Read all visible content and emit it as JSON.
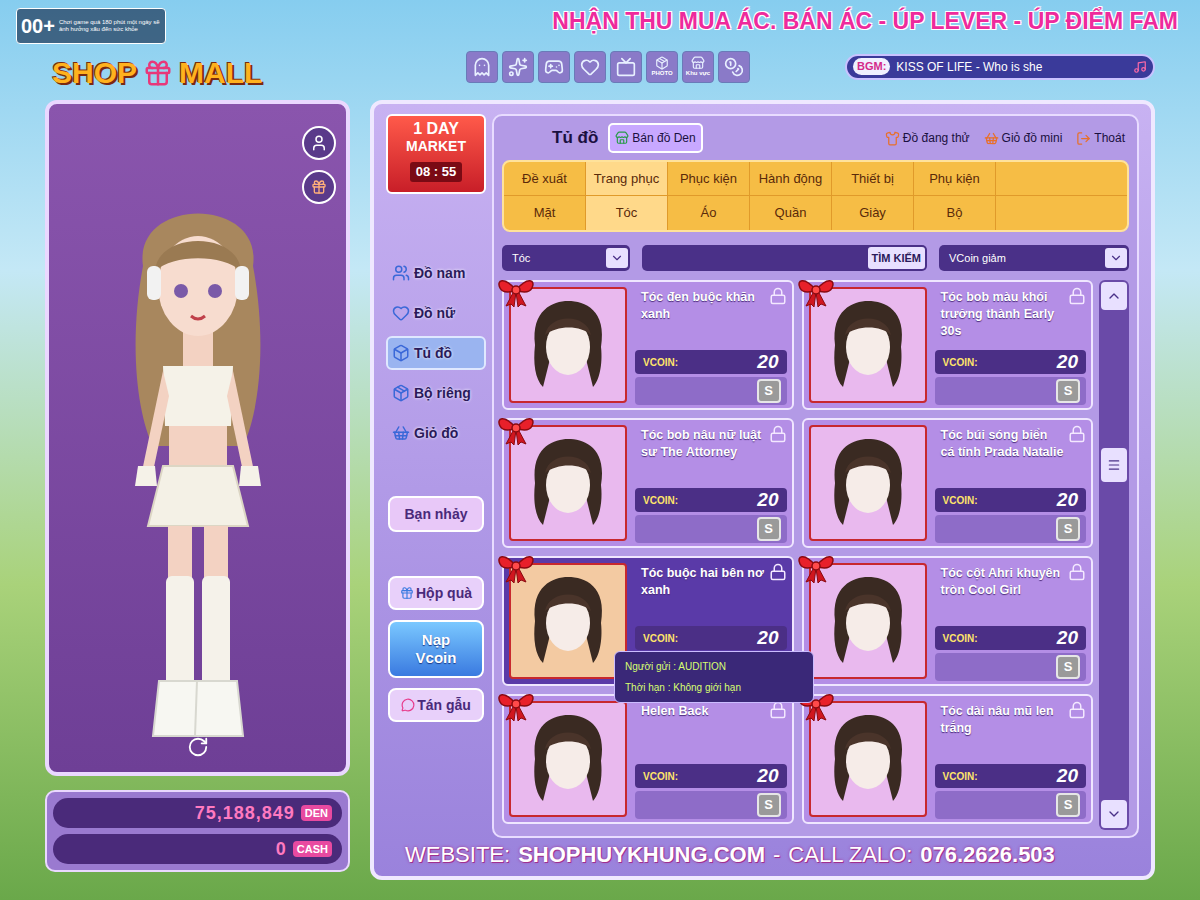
{
  "rating": {
    "badge": "00+",
    "warning": "Chơi game quá 180 phút một ngày sẽ ảnh hưởng xấu đến sức khỏe"
  },
  "logo": {
    "left": "SHOP",
    "right": "MALL"
  },
  "banner": "NHẬN THU MUA ÁC. BÁN ÁC - ÚP LEVER - ÚP ĐIỂM FAM",
  "top_icons": [
    {
      "kind": "plain"
    },
    {
      "kind": "plain"
    },
    {
      "kind": "plain"
    },
    {
      "kind": "plain"
    },
    {
      "kind": "plain"
    },
    {
      "kind": "labeled",
      "label": "PHOTO"
    },
    {
      "kind": "labeled",
      "label": "Khu vực"
    },
    {
      "kind": "plain"
    }
  ],
  "bgm": {
    "label": "BGM:",
    "track": "KISS OF LIFE - Who is she"
  },
  "market": {
    "line1": "1 DAY",
    "line2": "MARKET",
    "timer": "08 : 55"
  },
  "nav": [
    {
      "label": "Đồ nam",
      "selected": false
    },
    {
      "label": "Đồ nữ",
      "selected": false
    },
    {
      "label": "Tủ đồ",
      "selected": true
    },
    {
      "label": "Bộ riêng",
      "selected": false
    },
    {
      "label": "Giỏ đồ",
      "selected": false
    }
  ],
  "partner_button": "Bạn nhảy",
  "side_buttons": [
    {
      "kind": "gift",
      "label": "Hộp quà"
    },
    {
      "kind": "topup",
      "label": "Nạp Vcoin"
    },
    {
      "kind": "chat",
      "label": "Tán gẫu"
    }
  ],
  "wallet": [
    {
      "amount": "75,188,849",
      "unit": "DEN"
    },
    {
      "amount": "0",
      "unit": "CASH"
    }
  ],
  "header": {
    "title": "Tủ đồ",
    "sell_button": "Bán đồ Den",
    "actions": [
      "Đồ đang thử",
      "Giỏ đồ mini",
      "Thoát"
    ]
  },
  "category_tabs": [
    {
      "label": "Đề xuất",
      "selected": false
    },
    {
      "label": "Trang phục",
      "selected": true
    },
    {
      "label": "Phục kiện",
      "selected": false
    },
    {
      "label": "Hành động",
      "selected": false
    },
    {
      "label": "Thiết bị",
      "selected": false
    },
    {
      "label": "Phụ kiện",
      "selected": false
    }
  ],
  "sub_tabs": [
    {
      "label": "Mặt",
      "selected": false
    },
    {
      "label": "Tóc",
      "selected": true
    },
    {
      "label": "Áo",
      "selected": false
    },
    {
      "label": "Quần",
      "selected": false
    },
    {
      "label": "Giày",
      "selected": false
    },
    {
      "label": "Bộ",
      "selected": false
    }
  ],
  "filter": {
    "category": "Tóc",
    "search_button": "TÌM KIẾM",
    "sort": "VCoin giảm"
  },
  "price_label": "VCOIN:",
  "sell_key": "S",
  "items": [
    {
      "name": "Tóc đen buộc khăn xanh",
      "price": "20",
      "gift": true,
      "selected": false
    },
    {
      "name": "Tóc bob màu khói trưởng thành Early 30s",
      "price": "20",
      "gift": true,
      "selected": false
    },
    {
      "name": "Tóc bob nâu nữ luật sư The Attorney",
      "price": "20",
      "gift": true,
      "selected": false
    },
    {
      "name": "Tóc búi sóng biển cá tính Prada Natalie",
      "price": "20",
      "gift": false,
      "selected": false
    },
    {
      "name": "Tóc buộc hai bên nơ xanh",
      "price": "20",
      "gift": true,
      "selected": true
    },
    {
      "name": "Tóc cột Ahri khuyên tròn Cool Girl",
      "price": "20",
      "gift": true,
      "selected": false
    },
    {
      "name": "Helen Back",
      "price": "20",
      "gift": true,
      "selected": false
    },
    {
      "name": "Tóc dài nâu mũ len trắng",
      "price": "20",
      "gift": true,
      "selected": false
    }
  ],
  "tooltip": {
    "sender": "Người gửi : AUDITION",
    "duration": "Thời hạn : Không giới hạn"
  },
  "scrollbar": {
    "level": 0.3
  },
  "footer": {
    "website_label": "WEBSITE:",
    "website": "SHOPHUYKHUNG.COM",
    "separator": "-",
    "call_label": "CALL ZALO:",
    "phone": "076.2626.503"
  }
}
